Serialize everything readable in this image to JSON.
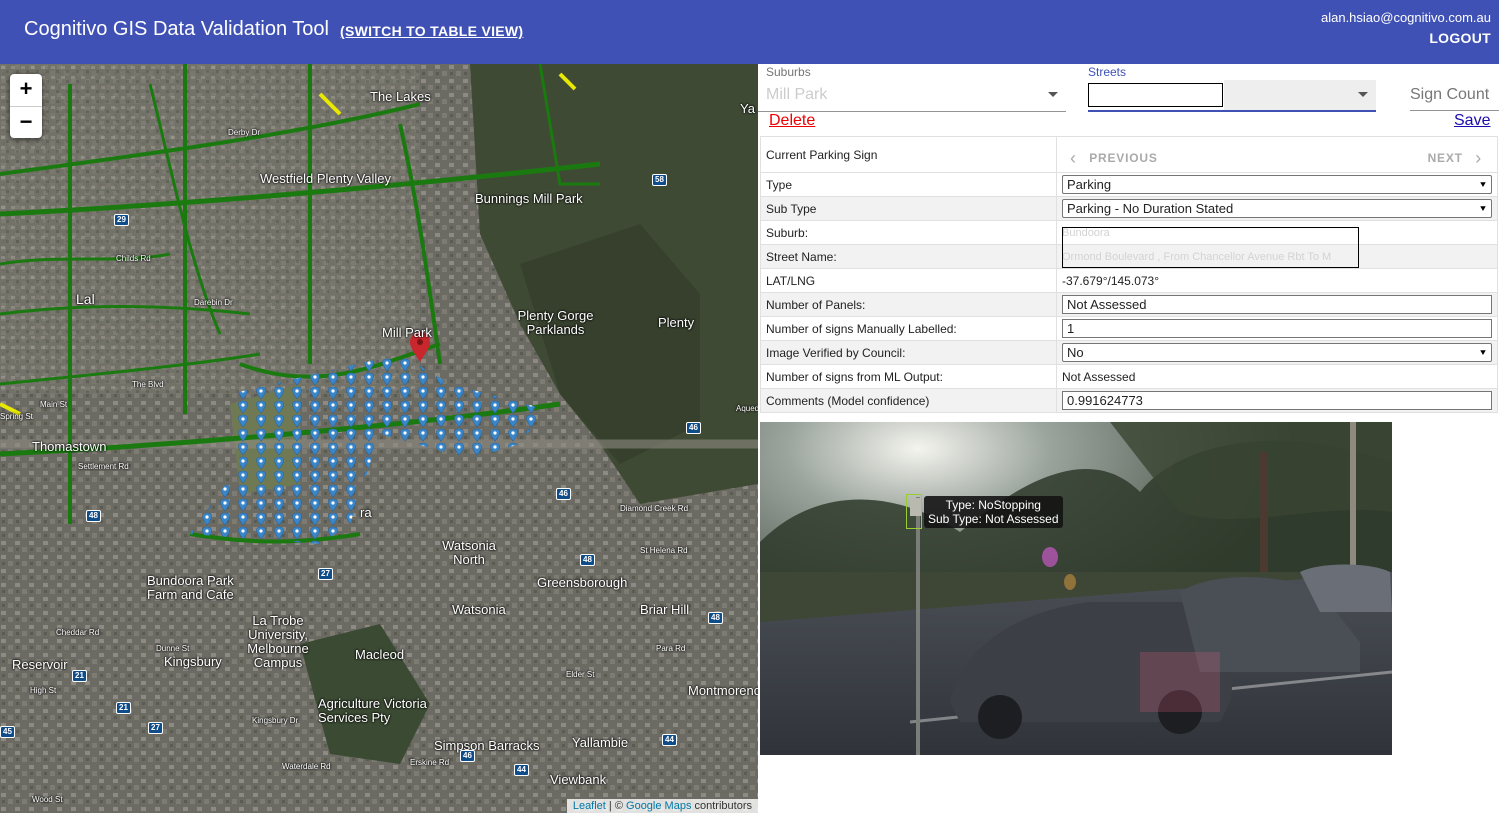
{
  "header": {
    "title": "Cognitivo GIS Data Validation Tool",
    "switch_label": "(SWITCH TO TABLE VIEW)",
    "user_email": "alan.hsiao@cognitivo.com.au",
    "logout_label": "LOGOUT",
    "color": "#3f51b5"
  },
  "map": {
    "zoom_in": "+",
    "zoom_out": "−",
    "labels": [
      "Westfield Plenty Valley",
      "Bunnings Mill Park",
      "Plenty Gorge Parklands",
      "Plenty",
      "Mill Park",
      "Thomastown",
      "Watsonia North",
      "Greensborough",
      "Watsonia",
      "Briar Hill",
      "Bundoora Park Farm and Cafe",
      "La Trobe University, Melbourne Campus",
      "Macleod",
      "Kingsbury",
      "Reservoir",
      "Agriculture Victoria Services Pty",
      "Simpson Barracks",
      "Yallambie",
      "Montmorency",
      "Viewbank",
      "Childs Rd",
      "Settlement Rd",
      "The Blvd",
      "Main St",
      "Spring St",
      "Dunne St",
      "Elder St",
      "Erskine Rd",
      "Wood St",
      "St Helena Rd",
      "Diamond Creek Rd",
      "Para Rd",
      "High St",
      "Cheddar Rd",
      "Waterdale Rd",
      "Kingsbury Dr",
      "Darebin Dr",
      "Derby Dr",
      "Aquedu",
      "Lal",
      "The Lakes",
      "ra",
      "Ya"
    ],
    "route_badges": [
      "58",
      "46",
      "46",
      "46",
      "48",
      "48",
      "48",
      "27",
      "27",
      "21",
      "21",
      "44",
      "44",
      "29",
      "45"
    ],
    "attribution": {
      "leaflet": "Leaflet",
      "sep": "| ©",
      "google": "Google Maps",
      "rest": "contributors"
    }
  },
  "filters": {
    "suburbs_label": "Suburbs",
    "suburbs_value": "Mill Park",
    "streets_label": "Streets",
    "sign_count_label": "Sign Count",
    "delete_label": "Delete",
    "save_label": "Save"
  },
  "record": {
    "header_label": "Current Parking Sign",
    "previous_label": "PREVIOUS",
    "next_label": "NEXT",
    "rows": {
      "type": {
        "label": "Type",
        "value": "Parking"
      },
      "subtype": {
        "label": "Sub Type",
        "value": "Parking - No Duration Stated"
      },
      "suburb": {
        "label": "Suburb:",
        "value": "Bundoora"
      },
      "street": {
        "label": "Street Name:",
        "value": "Ormond Boulevard , From Chancellor Avenue Rbt To M"
      },
      "latlng": {
        "label": "LAT/LNG",
        "value": "-37.679°/145.073°"
      },
      "panels": {
        "label": "Number of Panels:",
        "value": "Not Assessed"
      },
      "manual": {
        "label": "Number of signs Manually Labelled:",
        "value": "1"
      },
      "verified": {
        "label": "Image Verified by Council:",
        "value": "No"
      },
      "ml": {
        "label": "Number of signs from ML Output:",
        "value": "Not Assessed"
      },
      "comments": {
        "label": "Comments (Model confidence)",
        "value": "0.991624773"
      }
    }
  },
  "photo": {
    "tag_line1": "Type: NoStopping",
    "tag_line2": "Sub Type: Not Assessed"
  }
}
